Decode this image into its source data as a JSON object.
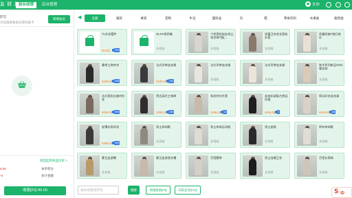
{
  "app": {
    "logo": "友 财 友"
  },
  "nav": {
    "tabs": [
      {
        "label": "前台收银"
      },
      {
        "label": "后台管理"
      }
    ]
  },
  "user": {
    "name": "文办"
  },
  "left_panel": {
    "member_label": "[F2]",
    "member_hint": "点击搜索框会员或扫描卡",
    "member_button": "新增会员",
    "history_link": "调出挂单商品历史",
    "history_arrow": ">",
    "rows": [
      {
        "label": "本单积分",
        "value": "0.00"
      },
      {
        "label": "会计金额",
        "value": "¥0.00"
      }
    ],
    "row_neg": [
      "0.00",
      "-0"
    ],
    "pay_button": "收款[F5] ¥0.00"
  },
  "categories": [
    "全部",
    "服装",
    "裤装",
    "定制",
    "牛记",
    "面料品",
    "包",
    "鞋",
    "零食饮料",
    "水果类",
    "服装类"
  ],
  "category_active": 0,
  "products": [
    {
      "name": "Tu文化摆件",
      "price": "¥5.0元",
      "stock": "999",
      "thumb": "bag"
    },
    {
      "name": "OLNY纸杯碟",
      "price": "",
      "stock": "",
      "multi": "多规格",
      "thumb": "bag"
    },
    {
      "name": "个性宽松娃娃领立领吊带T恤(...",
      "price": "",
      "stock": "",
      "multi": "多规格",
      "thumb": "photo",
      "c": "#d9d4cf"
    },
    {
      "name": "男童卫衣毛衣宽松外套",
      "price": "",
      "stock": "",
      "multi": "多规格",
      "thumb": "photo",
      "c": "#8a7a6e"
    },
    {
      "name": "男童短袖T恤打底衫",
      "price": "",
      "stock": "",
      "multi": "多规格",
      "thumb": "photo",
      "c": "#e9e0d6"
    },
    {
      "name": "春季工装夹克",
      "price": "¥188.00",
      "stock": "998",
      "thumb": "photo",
      "c": "#2a2a2a"
    },
    {
      "name": "法式吊带连衣裙",
      "price": "¥128.00",
      "stock": "194",
      "thumb": "photo",
      "c": "#3a3b3e"
    },
    {
      "name": "法式吊带连衣裙",
      "price": "",
      "stock": "",
      "multi": "多规格",
      "thumb": "photo",
      "c": "#e8e5df"
    },
    {
      "name": "法式吊带连衣裙",
      "price": "",
      "stock": "",
      "multi": "多规格",
      "thumb": "photo",
      "c": "#ece4d9"
    },
    {
      "name": "秋冬系列新品2022春女装",
      "price": "",
      "stock": "",
      "multi": "多规格",
      "thumb": "photo",
      "c": "#d9cbb8"
    },
    {
      "name": "法式宽松长袖衬衫女",
      "price": "¥195.00",
      "stock": "999",
      "thumb": "photo",
      "c": "#7a6a5e"
    },
    {
      "name": "黑白英伦工装裤",
      "price": "¥290.00",
      "stock": "198",
      "thumb": "photo",
      "c": "#2e2c2c"
    },
    {
      "name": "条纹衬衫外套",
      "price": "¥198.00",
      "stock": "10",
      "thumb": "photo",
      "c": "#c9b9a8"
    },
    {
      "name": "丝绒长裙复古宫廷风裙",
      "price": "¥165.00",
      "stock": "1",
      "thumb": "photo",
      "c": "#1e1e1e"
    },
    {
      "name": "简洁印花连衣裙",
      "price": "¥429.00",
      "stock": "88",
      "thumb": "photo",
      "c": "#d8d2c8"
    },
    {
      "name": "轻薄长款风衣",
      "price": "¥368.00",
      "stock": "999",
      "thumb": "photo",
      "c": "#3c3a38"
    },
    {
      "name": "男士休闲鞋",
      "price": "",
      "stock": "",
      "multi": "多规格",
      "thumb": "photo",
      "c": "#8e8a7e"
    },
    {
      "name": "男士休闲运动鞋",
      "price": "",
      "stock": "",
      "multi": "多规格",
      "thumb": "photo",
      "c": "#dedbd4"
    },
    {
      "name": "男士皮鞋",
      "price": "",
      "stock": "",
      "multi": "多规格",
      "thumb": "photo",
      "c": "#2a2a2a"
    },
    {
      "name": "帆布休闲鞋",
      "price": "",
      "stock": "",
      "multi": "多规格",
      "thumb": "photo",
      "c": "#e1ddd5"
    },
    {
      "name": "夏日出游帽",
      "price": "",
      "stock": "",
      "multi": "多规格",
      "thumb": "photo",
      "c": "#b89a6a"
    },
    {
      "name": "夏日出游渔夫帽",
      "price": "",
      "stock": "",
      "multi": "多规格",
      "thumb": "photo",
      "c": "#c8b8a8"
    },
    {
      "name": "百搭腰带",
      "price": "",
      "stock": "",
      "multi": "多规格",
      "thumb": "photo",
      "c": "#d4cfc7"
    },
    {
      "name": "男士连帽卫衣",
      "price": "",
      "stock": "",
      "multi": "多规格",
      "thumb": "photo",
      "c": "#1c1c1c"
    },
    {
      "name": "百搭长筒袜",
      "price": "",
      "stock": "",
      "multi": "多规格",
      "thumb": "photo",
      "c": "#cfc6bb"
    }
  ],
  "bottom": {
    "search_placeholder": "条码/名称/首字母",
    "search_button": "搜索",
    "quick_buttons": [
      "快速收款[F8]",
      "扫码支付[F10]"
    ]
  },
  "brand_text": "中"
}
